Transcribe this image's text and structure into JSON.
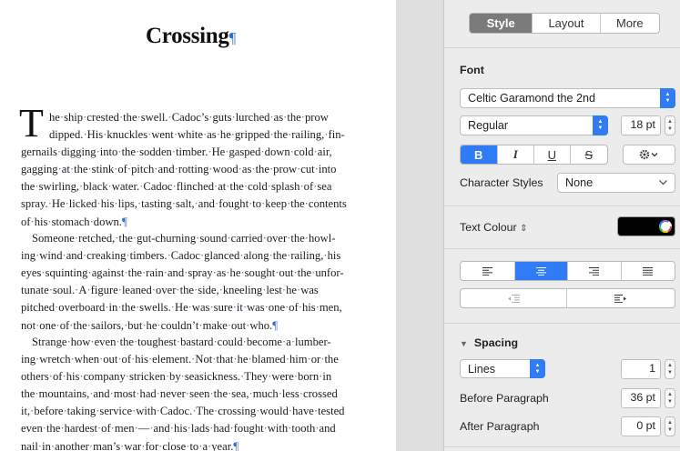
{
  "document": {
    "title": "Crossing",
    "pilcrow": "¶",
    "drop_cap": "T",
    "lines": [
      {
        "t": "he·ship·crested·the·swell.·Cadoc’s·guts·lurched·as·the·prow",
        "c": "cap j"
      },
      {
        "t": "dipped.·His·knuckles·went·white·as·he·gripped·the·railing,·fin-",
        "c": "cap j"
      },
      {
        "t": "gernails·digging·into·the·sodden·timber.·He·gasped·down·cold·air,",
        "c": "j"
      },
      {
        "t": "gagging·at·the·stink·of·pitch·and·rotting·wood·as·the·prow·cut·into",
        "c": "j"
      },
      {
        "t": "the·swirling,·black·water.·Cadoc·flinched·at·the·cold·splash·of·sea",
        "c": "j"
      },
      {
        "t": "spray.·He·licked·his·lips,·tasting·salt,·and·fought·to·keep·the·contents",
        "c": "j"
      },
      {
        "t": "of·his·stomach·down.¶",
        "c": ""
      },
      {
        "t": "Someone·retched,·the·gut-churning·sound·carried·over·the·howl-",
        "c": "ind j"
      },
      {
        "t": "ing·wind·and·creaking·timbers.·Cadoc·glanced·along·the·railing,·his",
        "c": "j"
      },
      {
        "t": "eyes·squinting·against·the·rain·and·spray·as·he·sought·out·the·unfor-",
        "c": "j"
      },
      {
        "t": "tunate·soul.·A·figure·leaned·over·the·side,·kneeling·lest·he·was",
        "c": "j"
      },
      {
        "t": "pitched·overboard·in·the·swells.·He·was·sure·it·was·one·of·his·men,",
        "c": "j"
      },
      {
        "t": "not·one·of·the·sailors,·but·he·couldn’t·make·out·who.¶",
        "c": ""
      },
      {
        "t": "Strange·how·even·the·toughest·bastard·could·become·a·lumber-",
        "c": "ind j"
      },
      {
        "t": "ing·wretch·when·out·of·his·element.·Not·that·he·blamed·him·or·the",
        "c": "j"
      },
      {
        "t": "others·of·his·company·stricken·by·seasickness.·They·were·born·in",
        "c": "j"
      },
      {
        "t": "the·mountains,·and·most·had·never·seen·the·sea,·much·less·crossed",
        "c": "j"
      },
      {
        "t": "it,·before·taking·service·with·Cadoc.·The·crossing·would·have·tested",
        "c": "j"
      },
      {
        "t": "even·the·hardest·of·men·—·and·his·lads·had·fought·with·tooth·and",
        "c": "j"
      },
      {
        "t": "nail·in·another·man’s·war·for·close·to·a·year.¶",
        "c": ""
      }
    ]
  },
  "inspector": {
    "tabs": [
      "Style",
      "Layout",
      "More"
    ],
    "active_tab": "Style",
    "font_heading": "Font",
    "font_name": "Celtic Garamond the 2nd",
    "font_style": "Regular",
    "font_size": "18 pt",
    "format_buttons": {
      "bold": "B",
      "italic": "I",
      "underline": "U",
      "strike": "S"
    },
    "character_styles_label": "Character Styles",
    "character_styles_value": "None",
    "text_colour_label": "Text Colour",
    "text_colour_value": "#000000",
    "active_alignment": "center",
    "spacing_heading": "Spacing",
    "line_spacing_mode": "Lines",
    "line_spacing_value": "1",
    "before_paragraph_label": "Before Paragraph",
    "before_paragraph_value": "36 pt",
    "after_paragraph_label": "After Paragraph",
    "after_paragraph_value": "0 pt",
    "accent_color": "#2f7cf6"
  }
}
